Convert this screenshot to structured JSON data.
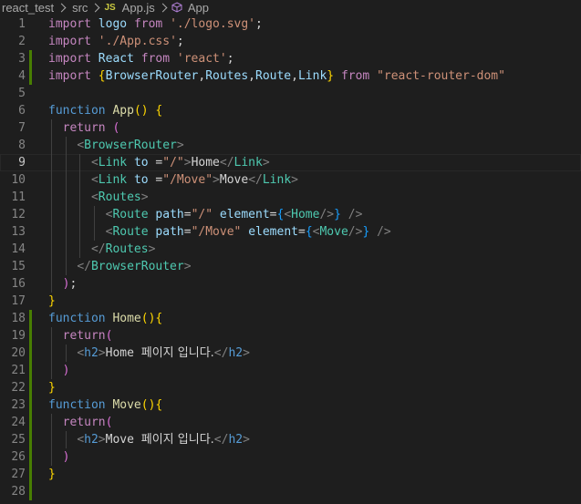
{
  "breadcrumb": {
    "folder1": "react_test",
    "folder2": "src",
    "file_badge": "JS",
    "file": "App.js",
    "symbol": "App"
  },
  "editor": {
    "current_line": 9,
    "modified_lines": [
      3,
      4,
      18,
      19,
      20,
      21,
      22,
      23,
      24,
      25,
      26,
      27,
      28
    ],
    "lines": [
      {
        "num": "1",
        "tokens": [
          [
            "kw",
            "import"
          ],
          [
            "text",
            " "
          ],
          [
            "var",
            "logo"
          ],
          [
            "text",
            " "
          ],
          [
            "kw",
            "from"
          ],
          [
            "text",
            " "
          ],
          [
            "str",
            "'./logo.svg'"
          ],
          [
            "text",
            ";"
          ]
        ]
      },
      {
        "num": "2",
        "tokens": [
          [
            "kw",
            "import"
          ],
          [
            "text",
            " "
          ],
          [
            "str",
            "'./App.css'"
          ],
          [
            "text",
            ";"
          ]
        ]
      },
      {
        "num": "3",
        "tokens": [
          [
            "kw",
            "import"
          ],
          [
            "text",
            " "
          ],
          [
            "var",
            "React"
          ],
          [
            "text",
            " "
          ],
          [
            "kw",
            "from"
          ],
          [
            "text",
            " "
          ],
          [
            "str",
            "'react'"
          ],
          [
            "text",
            ";"
          ]
        ]
      },
      {
        "num": "4",
        "tokens": [
          [
            "kw",
            "import"
          ],
          [
            "text",
            " "
          ],
          [
            "b1",
            "{"
          ],
          [
            "var",
            "BrowserRouter"
          ],
          [
            "text",
            ","
          ],
          [
            "var",
            "Routes"
          ],
          [
            "text",
            ","
          ],
          [
            "var",
            "Route"
          ],
          [
            "text",
            ","
          ],
          [
            "var",
            "Link"
          ],
          [
            "b1",
            "}"
          ],
          [
            "text",
            " "
          ],
          [
            "kw",
            "from"
          ],
          [
            "text",
            " "
          ],
          [
            "str",
            "\"react-router-dom\""
          ]
        ]
      },
      {
        "num": "5",
        "tokens": []
      },
      {
        "num": "6",
        "tokens": [
          [
            "decl",
            "function"
          ],
          [
            "text",
            " "
          ],
          [
            "fn",
            "App"
          ],
          [
            "b1",
            "()"
          ],
          [
            "text",
            " "
          ],
          [
            "b1",
            "{"
          ]
        ]
      },
      {
        "num": "7",
        "tokens": [
          [
            "text",
            "  "
          ],
          [
            "kw",
            "return"
          ],
          [
            "text",
            " "
          ],
          [
            "b2",
            "("
          ]
        ]
      },
      {
        "num": "8",
        "tokens": [
          [
            "text",
            "    "
          ],
          [
            "punc",
            "<"
          ],
          [
            "tag",
            "BrowserRouter"
          ],
          [
            "punc",
            ">"
          ]
        ]
      },
      {
        "num": "9",
        "tokens": [
          [
            "text",
            "      "
          ],
          [
            "punc",
            "<"
          ],
          [
            "tag",
            "Link"
          ],
          [
            "text",
            " "
          ],
          [
            "var",
            "to"
          ],
          [
            "text",
            " ="
          ],
          [
            "str",
            "\"/\""
          ],
          [
            "punc",
            ">"
          ],
          [
            "text",
            "Home"
          ],
          [
            "punc",
            "</"
          ],
          [
            "tag",
            "Link"
          ],
          [
            "punc",
            ">"
          ]
        ]
      },
      {
        "num": "10",
        "tokens": [
          [
            "text",
            "      "
          ],
          [
            "punc",
            "<"
          ],
          [
            "tag",
            "Link"
          ],
          [
            "text",
            " "
          ],
          [
            "var",
            "to"
          ],
          [
            "text",
            " ="
          ],
          [
            "str",
            "\"/Move\""
          ],
          [
            "punc",
            ">"
          ],
          [
            "text",
            "Move"
          ],
          [
            "punc",
            "</"
          ],
          [
            "tag",
            "Link"
          ],
          [
            "punc",
            ">"
          ]
        ]
      },
      {
        "num": "11",
        "tokens": [
          [
            "text",
            "      "
          ],
          [
            "punc",
            "<"
          ],
          [
            "tag",
            "Routes"
          ],
          [
            "punc",
            ">"
          ]
        ]
      },
      {
        "num": "12",
        "tokens": [
          [
            "text",
            "        "
          ],
          [
            "punc",
            "<"
          ],
          [
            "tag",
            "Route"
          ],
          [
            "text",
            " "
          ],
          [
            "var",
            "path"
          ],
          [
            "text",
            "="
          ],
          [
            "str",
            "\"/\""
          ],
          [
            "text",
            " "
          ],
          [
            "var",
            "element"
          ],
          [
            "text",
            "="
          ],
          [
            "b3",
            "{"
          ],
          [
            "punc",
            "<"
          ],
          [
            "tag",
            "Home"
          ],
          [
            "punc",
            "/>"
          ],
          [
            "b3",
            "}"
          ],
          [
            "text",
            " "
          ],
          [
            "punc",
            "/>"
          ]
        ]
      },
      {
        "num": "13",
        "tokens": [
          [
            "text",
            "        "
          ],
          [
            "punc",
            "<"
          ],
          [
            "tag",
            "Route"
          ],
          [
            "text",
            " "
          ],
          [
            "var",
            "path"
          ],
          [
            "text",
            "="
          ],
          [
            "str",
            "\"/Move\""
          ],
          [
            "text",
            " "
          ],
          [
            "var",
            "element"
          ],
          [
            "text",
            "="
          ],
          [
            "b3",
            "{"
          ],
          [
            "punc",
            "<"
          ],
          [
            "tag",
            "Move"
          ],
          [
            "punc",
            "/>"
          ],
          [
            "b3",
            "}"
          ],
          [
            "text",
            " "
          ],
          [
            "punc",
            "/>"
          ]
        ]
      },
      {
        "num": "14",
        "tokens": [
          [
            "text",
            "      "
          ],
          [
            "punc",
            "</"
          ],
          [
            "tag",
            "Routes"
          ],
          [
            "punc",
            ">"
          ]
        ]
      },
      {
        "num": "15",
        "tokens": [
          [
            "text",
            "    "
          ],
          [
            "punc",
            "</"
          ],
          [
            "tag",
            "BrowserRouter"
          ],
          [
            "punc",
            ">"
          ]
        ]
      },
      {
        "num": "16",
        "tokens": [
          [
            "text",
            "  "
          ],
          [
            "b2",
            ")"
          ],
          [
            "text",
            ";"
          ]
        ]
      },
      {
        "num": "17",
        "tokens": [
          [
            "b1",
            "}"
          ]
        ]
      },
      {
        "num": "18",
        "tokens": [
          [
            "decl",
            "function"
          ],
          [
            "text",
            " "
          ],
          [
            "fn",
            "Home"
          ],
          [
            "b1",
            "()"
          ],
          [
            "b1",
            "{"
          ]
        ]
      },
      {
        "num": "19",
        "tokens": [
          [
            "text",
            "  "
          ],
          [
            "kw",
            "return"
          ],
          [
            "b2",
            "("
          ]
        ]
      },
      {
        "num": "20",
        "tokens": [
          [
            "text",
            "    "
          ],
          [
            "punc",
            "<"
          ],
          [
            "decl",
            "h2"
          ],
          [
            "punc",
            ">"
          ],
          [
            "text",
            "Home "
          ],
          [
            "cjk",
            "페이지 입니다."
          ],
          [
            "punc",
            "</"
          ],
          [
            "decl",
            "h2"
          ],
          [
            "punc",
            ">"
          ]
        ]
      },
      {
        "num": "21",
        "tokens": [
          [
            "text",
            "  "
          ],
          [
            "b2",
            ")"
          ]
        ]
      },
      {
        "num": "22",
        "tokens": [
          [
            "b1",
            "}"
          ]
        ]
      },
      {
        "num": "23",
        "tokens": [
          [
            "decl",
            "function"
          ],
          [
            "text",
            " "
          ],
          [
            "fn",
            "Move"
          ],
          [
            "b1",
            "()"
          ],
          [
            "b1",
            "{"
          ]
        ]
      },
      {
        "num": "24",
        "tokens": [
          [
            "text",
            "  "
          ],
          [
            "kw",
            "return"
          ],
          [
            "b2",
            "("
          ]
        ]
      },
      {
        "num": "25",
        "tokens": [
          [
            "text",
            "    "
          ],
          [
            "punc",
            "<"
          ],
          [
            "decl",
            "h2"
          ],
          [
            "punc",
            ">"
          ],
          [
            "text",
            "Move "
          ],
          [
            "cjk",
            "페이지 입니다."
          ],
          [
            "punc",
            "</"
          ],
          [
            "decl",
            "h2"
          ],
          [
            "punc",
            ">"
          ]
        ]
      },
      {
        "num": "26",
        "tokens": [
          [
            "text",
            "  "
          ],
          [
            "b2",
            ")"
          ]
        ]
      },
      {
        "num": "27",
        "tokens": [
          [
            "b1",
            "}"
          ]
        ]
      },
      {
        "num": "28",
        "tokens": []
      }
    ]
  },
  "colors": {
    "background": "#1e1e1e",
    "keyword": "#c586c0",
    "declaration": "#569cd6",
    "function": "#dcdcaa",
    "variable": "#9cdcfe",
    "string": "#ce9178",
    "tag": "#4ec9b0",
    "modified_bar": "#487e02"
  }
}
